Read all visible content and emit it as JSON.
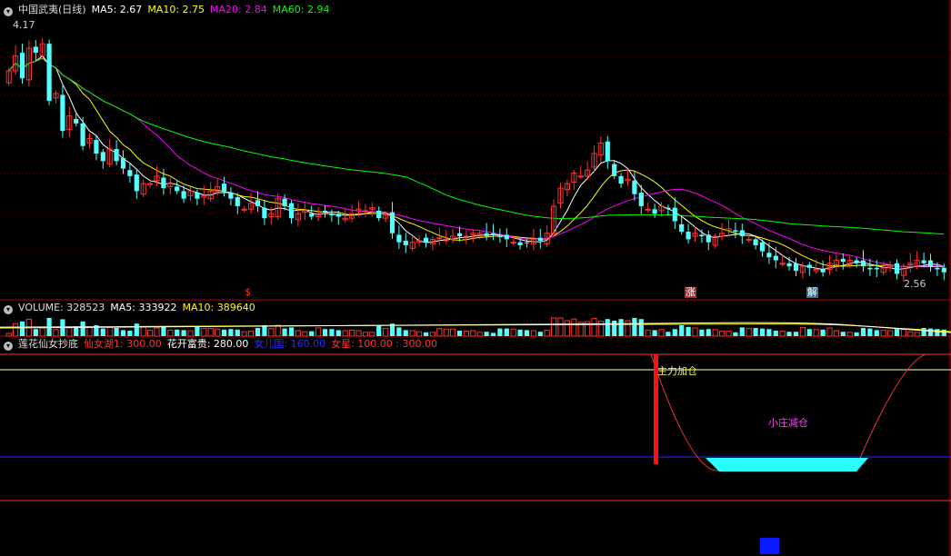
{
  "colors": {
    "up": "#ff3232",
    "down": "#54ffff",
    "ma5": "#ffffff",
    "ma10": "#ffff00",
    "ma20": "#ff00ff",
    "ma60": "#00ff00",
    "grid": "#7a0000",
    "divider": "#b00000"
  },
  "header_main": {
    "title": "中国武夷(日线)",
    "ma5": "MA5: 2.67",
    "ma10": "MA10: 2.75",
    "ma20": "MA20: 2.84",
    "ma60": "MA60: 2.94"
  },
  "header_volume": {
    "title": "VOLUME: 328523",
    "ma5": "MA5: 333922",
    "ma10": "MA10: 389640"
  },
  "header_indicator": {
    "title": "莲花仙女抄底",
    "l1": "仙女湖1: 300.00",
    "l2": "花开富贵: 280.00",
    "l3": "女儿国: 160.00",
    "l4": "女星: 100.00 : 300.00"
  },
  "price_labels": {
    "high": "4.17",
    "low": "2.56"
  },
  "badges": [
    "$",
    "涨",
    "解"
  ],
  "annotations": {
    "main_add": "主力加仓",
    "small_reduce": "小庄减仓"
  },
  "icons": {
    "collapse": "chevron-down-icon"
  },
  "chart_data": [
    {
      "type": "candlestick",
      "title": "中国武夷(日线)",
      "y_range": [
        2.45,
        4.25
      ],
      "marked_values": {
        "high": 4.17,
        "low": 2.56
      },
      "ma_latest": {
        "MA5": 2.67,
        "MA10": 2.75,
        "MA20": 2.84,
        "MA60": 2.94
      },
      "closes": [
        3.9,
        4.0,
        3.85,
        4.05,
        4.02,
        4.08,
        3.7,
        3.75,
        3.5,
        3.6,
        3.55,
        3.4,
        3.45,
        3.35,
        3.3,
        3.38,
        3.3,
        3.25,
        3.2,
        3.1,
        3.15,
        3.15,
        3.2,
        3.12,
        3.15,
        3.1,
        3.05,
        3.1,
        3.05,
        3.07,
        3.1,
        3.13,
        3.1,
        3.05,
        3.0,
        2.98,
        3.02,
        3.0,
        2.92,
        2.95,
        3.05,
        3.0,
        2.92,
        2.95,
        2.97,
        2.93,
        2.95,
        2.96,
        2.94,
        2.93,
        2.92,
        2.95,
        2.98,
        2.97,
        2.99,
        2.92,
        2.94,
        2.82,
        2.76,
        2.74,
        2.76,
        2.77,
        2.76,
        2.78,
        2.79,
        2.78,
        2.8,
        2.8,
        2.8,
        2.82,
        2.82,
        2.8,
        2.81,
        2.8,
        2.78,
        2.76,
        2.74,
        2.76,
        2.78,
        2.77,
        2.82,
        3.0,
        3.12,
        3.15,
        3.22,
        3.2,
        3.24,
        3.35,
        3.42,
        3.3,
        3.2,
        3.15,
        3.18,
        3.08,
        3.0,
        2.98,
        2.95,
        3.0,
        2.98,
        2.9,
        2.83,
        2.78,
        2.82,
        2.8,
        2.76,
        2.8,
        2.82,
        2.85,
        2.83,
        2.8,
        2.78,
        2.74,
        2.7,
        2.66,
        2.64,
        2.62,
        2.6,
        2.57,
        2.6,
        2.59,
        2.58,
        2.56,
        2.62,
        2.64,
        2.63,
        2.64,
        2.62,
        2.6,
        2.58,
        2.58,
        2.59,
        2.6,
        2.55,
        2.6,
        2.62,
        2.64,
        2.62,
        2.6,
        2.58,
        2.56
      ]
    },
    {
      "type": "bar",
      "title": "VOLUME",
      "latest": {
        "VOLUME": 328523,
        "MA5": 333922,
        "MA10": 389640
      }
    },
    {
      "type": "line",
      "title": "莲花仙女抄底",
      "levels": {
        "仙女湖1": 300.0,
        "花开富贵": 280.0,
        "女儿国": 160.0,
        "女星": [
          100.0,
          300.0
        ]
      }
    }
  ]
}
